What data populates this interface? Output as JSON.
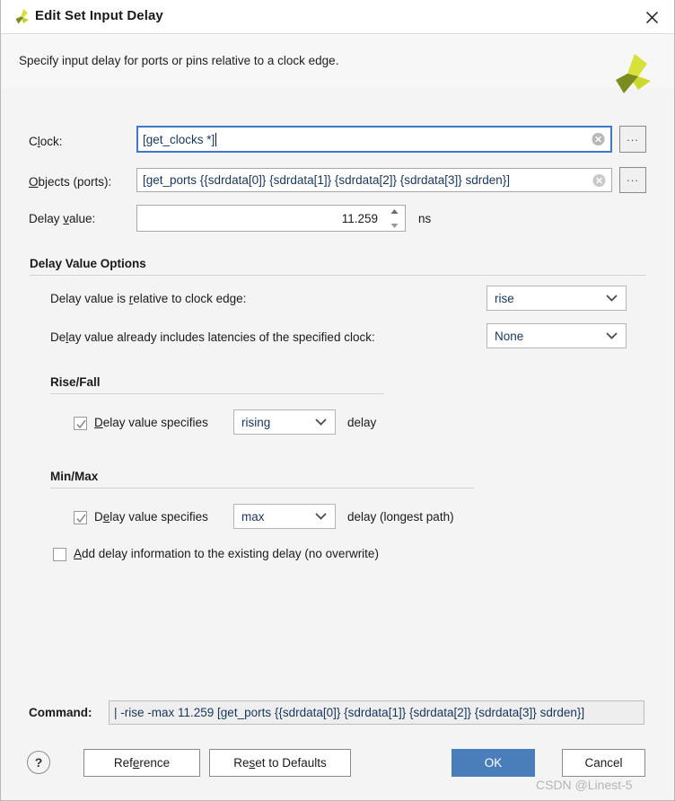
{
  "window": {
    "title": "Edit Set Input Delay",
    "logo_icon": "vivado-pinwheel-icon",
    "close_icon": "close-icon"
  },
  "header": {
    "description": "Specify input delay for ports or pins relative to a clock edge.",
    "brand_icon": "vivado-pinwheel-icon"
  },
  "fields": {
    "clock": {
      "label_pre": "C",
      "label_mn": "l",
      "label_post": "ock:",
      "value": "[get_clocks *]",
      "focused": true,
      "clear_icon": "clear-circle-icon",
      "browse_label": "..."
    },
    "objects": {
      "label_pre": "",
      "label_mn": "O",
      "label_post": "bjects (ports):",
      "value": "[get_ports {{sdrdata[0]} {sdrdata[1]} {sdrdata[2]} {sdrdata[3]} sdrden}]",
      "clear_icon": "clear-circle-icon",
      "browse_label": "..."
    },
    "delay_value": {
      "label_pre": "Delay ",
      "label_mn": "v",
      "label_post": "alue:",
      "value": "11.259",
      "unit": "ns",
      "spinner_up_icon": "spinner-up-icon",
      "spinner_down_icon": "spinner-down-icon"
    }
  },
  "delay_options": {
    "title": "Delay Value Options",
    "relative_row": {
      "label_pre": "Delay value is ",
      "label_mn": "r",
      "label_post": "elative to clock edge:",
      "value": "rise",
      "chevron_icon": "chevron-down-icon"
    },
    "latencies_row": {
      "label_pre": "De",
      "label_mn": "l",
      "label_post": "ay value already includes latencies of the specified clock:",
      "value": "None",
      "chevron_icon": "chevron-down-icon"
    }
  },
  "rise_fall": {
    "title": "Rise/Fall",
    "checkbox_checked": true,
    "check_icon": "checkmark-icon",
    "label_pre": "",
    "label_mn": "D",
    "label_post": "elay value specifies",
    "value": "rising",
    "chevron_icon": "chevron-down-icon",
    "suffix": "delay"
  },
  "min_max": {
    "title": "Min/Max",
    "checkbox_checked": true,
    "check_icon": "checkmark-icon",
    "label_pre": "D",
    "label_mn": "e",
    "label_post": "lay value specifies",
    "value": "max",
    "chevron_icon": "chevron-down-icon",
    "suffix": "delay (longest path)",
    "add_delay": {
      "checked": false,
      "label_pre": "",
      "label_mn": "A",
      "label_post": "dd delay information to the existing delay (no overwrite)"
    }
  },
  "footer": {
    "command_label": "Command:",
    "command_value": "| -rise -max 11.259 [get_ports {{sdrdata[0]} {sdrdata[1]} {sdrdata[2]} {sdrdata[3]} sdrden}]",
    "help_label": "?",
    "reference": {
      "pre": "Ref",
      "mn": "e",
      "post": "rence"
    },
    "reset": {
      "pre": "Re",
      "mn": "s",
      "post": "et to Defaults"
    },
    "ok_label": "OK",
    "cancel_label": "Cancel"
  },
  "watermark": "CSDN @Linest-5",
  "colors": {
    "accent": "#4a7ebb",
    "focus_border": "#3f78c8",
    "field_text": "#17365d",
    "logo_dark": "#7d8c1e",
    "logo_light": "#d6e23a"
  }
}
